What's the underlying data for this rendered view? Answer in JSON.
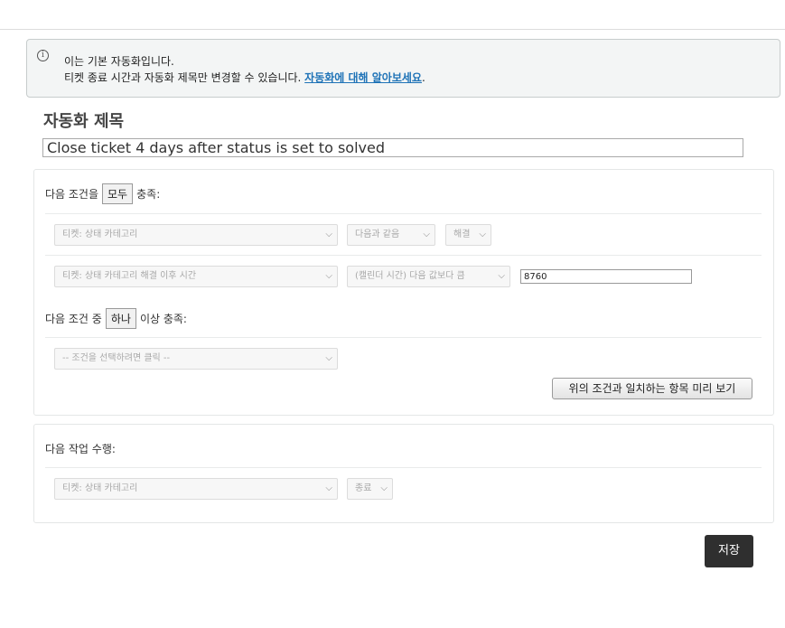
{
  "notice": {
    "line1": "이는 기본 자동화입니다.",
    "line2_prefix": "티켓 종료 시간과 자동화 제목만 변경할 수 있습니다. ",
    "link": "자동화에 대해 알아보세요",
    "line2_suffix": "."
  },
  "title": {
    "label": "자동화 제목",
    "value": "Close ticket 4 days after status is set to solved"
  },
  "conditions_all": {
    "prefix": "다음 조건을",
    "chip": "모두",
    "suffix": "충족:",
    "rows": [
      {
        "field": "티켓: 상태 카테고리",
        "operator": "다음과 같음",
        "value": "해결"
      },
      {
        "field": "티켓: 상태 카테고리 해결 이후 시간",
        "operator": "(캘린더 시간) 다음 값보다 큼",
        "value": "8760"
      }
    ]
  },
  "conditions_any": {
    "prefix": "다음 조건 중",
    "chip": "하나",
    "suffix": "이상 충족:",
    "placeholder": "-- 조건을 선택하려면 클릭 --"
  },
  "preview_button": "위의 조건과 일치하는 항목 미리 보기",
  "actions": {
    "heading": "다음 작업 수행:",
    "field": "티켓: 상태 카테고리",
    "value": "종료"
  },
  "save_button": "저장",
  "icons": {
    "info": "info-icon",
    "chevron": "chevron-down-icon"
  }
}
